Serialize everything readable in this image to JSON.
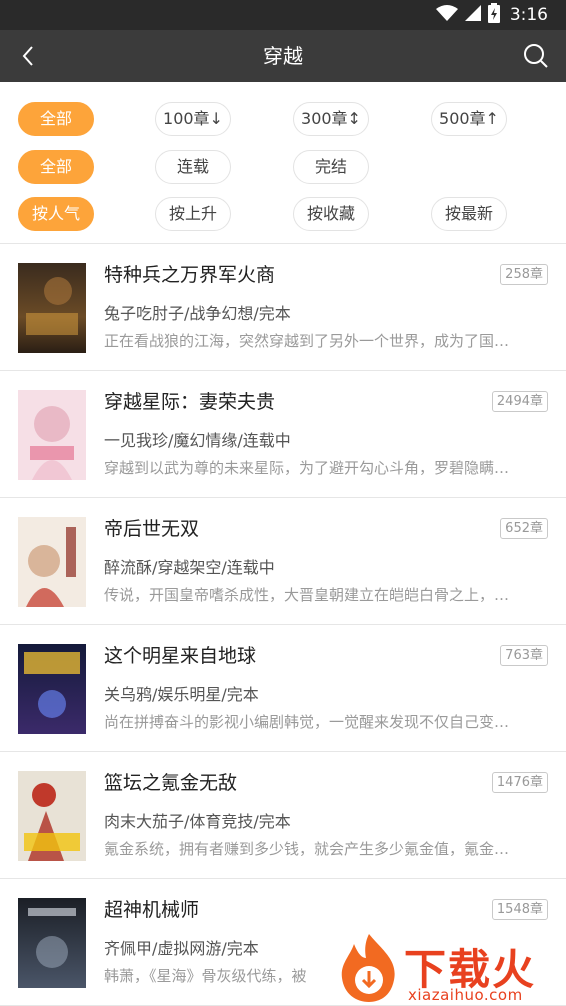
{
  "status_bar": {
    "time": "3:16"
  },
  "app_bar": {
    "title": "穿越"
  },
  "filters": {
    "length": [
      "全部",
      "100章↓",
      "300章↕",
      "500章↑"
    ],
    "status": [
      "全部",
      "连载",
      "完结"
    ],
    "sort": [
      "按人气",
      "按上升",
      "按收藏",
      "按最新"
    ]
  },
  "books": [
    {
      "title": "特种兵之万界军火商",
      "chapters": "258章",
      "meta": "兔子吃肘子/战争幻想/完本",
      "desc": "正在看战狼的江海，突然穿越到了另外一个世界，成为了国…"
    },
    {
      "title": "穿越星际：妻荣夫贵",
      "chapters": "2494章",
      "meta": "一见我珍/魔幻情缘/连载中",
      "desc": "穿越到以武为尊的未来星际，为了避开勾心斗角，罗碧隐瞒…"
    },
    {
      "title": "帝后世无双",
      "chapters": "652章",
      "meta": "醉流酥/穿越架空/连载中",
      "desc": "传说，开国皇帝嗜杀成性，大晋皇朝建立在皑皑白骨之上，…"
    },
    {
      "title": "这个明星来自地球",
      "chapters": "763章",
      "meta": "关乌鸦/娱乐明星/完本",
      "desc": "尚在拼搏奋斗的影视小编剧韩觉，一觉醒来发现不仅自己变…"
    },
    {
      "title": "篮坛之氪金无敌",
      "chapters": "1476章",
      "meta": "肉末大茄子/体育竞技/完本",
      "desc": "氪金系统，拥有者赚到多少钱，就会产生多少氪金值，氪金…"
    },
    {
      "title": "超神机械师",
      "chapters": "1548章",
      "meta": "齐佩甲/虚拟网游/完本",
      "desc": "韩萧，《星海》骨灰级代练，被"
    }
  ],
  "watermark": {
    "brand": "下载火",
    "url": "xiazaihuo.com"
  },
  "colors": {
    "accent": "#fda43a",
    "app_bar": "#3b3b3b",
    "status_bar": "#2a2a2a"
  }
}
